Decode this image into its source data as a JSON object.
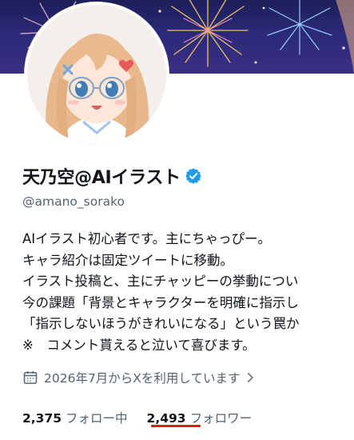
{
  "profile": {
    "display_name": "天乃空@AIイラスト",
    "handle": "@amano_sorako",
    "verified": true,
    "bio_lines": [
      "AIイラスト初心者です。主にちゃっぴー。",
      "キャラ紹介は固定ツイートに移動。",
      "イラスト投稿と、主にチャッピーの挙動につい",
      "今の課題「背景とキャラクターを明確に指示し",
      "「指示しないほうがきれいになる」という罠か",
      "※　コメント貰えると泣いて喜びます。"
    ],
    "joined": "2026年7月からXを利用しています"
  },
  "stats": {
    "following_count": "2,375",
    "following_label": "フォロー中",
    "followers_count": "2,493",
    "followers_label": "フォロワー"
  },
  "icons": {
    "verified": "verified-badge-icon",
    "calendar": "calendar-icon",
    "chevron": "chevron-right-icon"
  },
  "colors": {
    "verified_blue": "#1d9bf0",
    "secondary_text": "#536471",
    "highlight_underline": "#d81e1e"
  }
}
